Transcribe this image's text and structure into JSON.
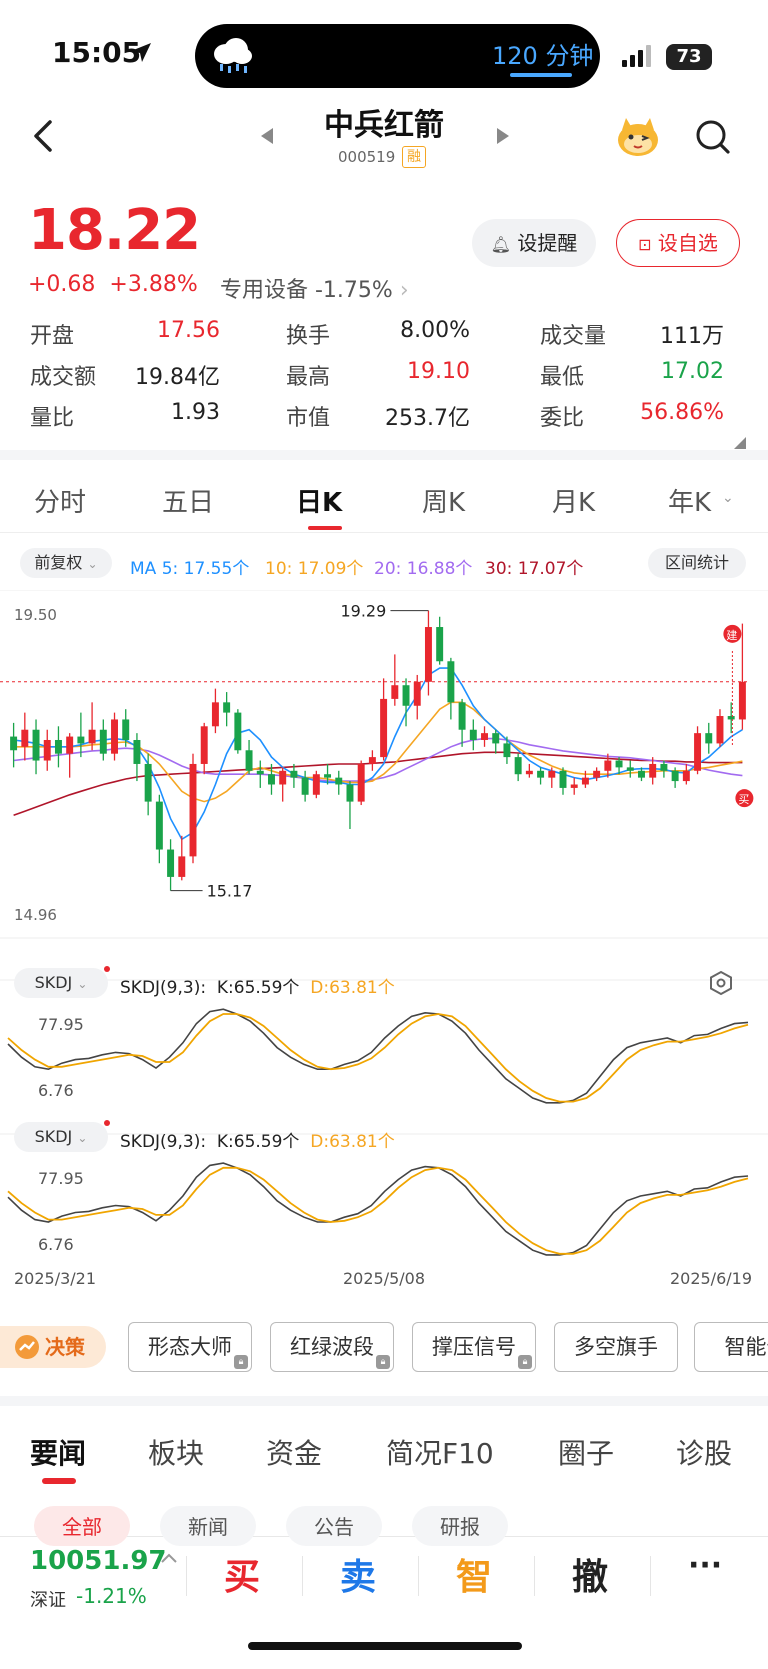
{
  "status_bar": {
    "time": "15:05",
    "timer": "120 分钟",
    "battery": "73"
  },
  "header": {
    "title": "中兵红箭",
    "code": "000519",
    "margin_badge": "融"
  },
  "quote": {
    "price": "18.22",
    "change": "+0.68",
    "change_pct": "+3.88%",
    "sector": "专用设备 -1.75%",
    "alert_label": "设提醒",
    "favorite_label": "设自选",
    "stats": [
      {
        "label": "开盘",
        "value": "17.56",
        "color": "#e8272e"
      },
      {
        "label": "换手",
        "value": "8.00%",
        "color": "#222"
      },
      {
        "label": "成交量",
        "value": "111万",
        "color": "#222"
      },
      {
        "label": "成交额",
        "value": "19.84亿",
        "color": "#222"
      },
      {
        "label": "最高",
        "value": "19.10",
        "color": "#e8272e"
      },
      {
        "label": "最低",
        "value": "17.02",
        "color": "#1aa34a"
      },
      {
        "label": "量比",
        "value": "1.93",
        "color": "#222"
      },
      {
        "label": "市值",
        "value": "253.7亿",
        "color": "#222"
      },
      {
        "label": "委比",
        "value": "56.86%",
        "color": "#e8272e"
      }
    ]
  },
  "kline_tabs": [
    "分时",
    "五日",
    "日K",
    "周K",
    "月K",
    "年K"
  ],
  "active_kline_tab": "日K",
  "chart_toolbar": {
    "adjust": "前复权",
    "ma5": "MA 5: 17.55个",
    "ma10": "10: 17.09个",
    "ma20": "20: 16.88个",
    "ma30": "30: 17.07个",
    "range_stats": "区间统计"
  },
  "indicator": {
    "name": "SKDJ",
    "params": "SKDJ(9,3):",
    "k": "K:65.59个",
    "d": "D:63.81个",
    "upper": "77.95",
    "lower": "6.76"
  },
  "chart_data": {
    "type": "candlestick",
    "y_max_label": "19.50",
    "y_min_label": "14.96",
    "high_marker": "19.29",
    "low_marker": "15.17",
    "x_labels": [
      "2025/3/21",
      "2025/5/08",
      "2025/6/19"
    ],
    "build_marker": "建",
    "buy_marker": "买",
    "candles": [
      [
        17.45,
        17.25,
        17.65,
        17.0
      ],
      [
        17.3,
        17.55,
        17.8,
        17.1
      ],
      [
        17.55,
        17.1,
        17.7,
        16.9
      ],
      [
        17.1,
        17.4,
        17.55,
        16.95
      ],
      [
        17.4,
        17.2,
        17.6,
        17.0
      ],
      [
        17.2,
        17.45,
        17.5,
        16.85
      ],
      [
        17.45,
        17.35,
        17.8,
        17.15
      ],
      [
        17.35,
        17.55,
        17.95,
        17.25
      ],
      [
        17.55,
        17.2,
        17.7,
        17.1
      ],
      [
        17.2,
        17.7,
        17.8,
        17.1
      ],
      [
        17.7,
        17.4,
        17.85,
        17.3
      ],
      [
        17.4,
        17.05,
        17.5,
        16.8
      ],
      [
        17.05,
        16.5,
        17.2,
        16.3
      ],
      [
        16.5,
        15.8,
        16.6,
        15.6
      ],
      [
        15.8,
        15.4,
        15.95,
        15.2
      ],
      [
        15.4,
        15.7,
        16.0,
        15.35
      ],
      [
        15.7,
        17.05,
        17.2,
        15.6
      ],
      [
        17.05,
        17.6,
        17.65,
        16.9
      ],
      [
        17.6,
        17.95,
        18.15,
        17.5
      ],
      [
        17.95,
        17.8,
        18.1,
        17.6
      ],
      [
        17.8,
        17.25,
        17.85,
        17.2
      ],
      [
        17.25,
        16.95,
        17.4,
        16.9
      ],
      [
        16.95,
        16.9,
        17.1,
        16.7
      ],
      [
        16.9,
        16.75,
        17.05,
        16.6
      ],
      [
        16.75,
        16.95,
        17.0,
        16.5
      ],
      [
        16.95,
        16.85,
        17.05,
        16.7
      ],
      [
        16.85,
        16.6,
        16.95,
        16.5
      ],
      [
        16.6,
        16.9,
        16.95,
        16.55
      ],
      [
        16.9,
        16.85,
        17.05,
        16.75
      ],
      [
        16.85,
        16.75,
        16.95,
        16.6
      ],
      [
        16.75,
        16.5,
        16.8,
        16.1
      ],
      [
        16.5,
        17.05,
        17.1,
        16.45
      ],
      [
        17.05,
        17.15,
        17.25,
        16.95
      ],
      [
        17.15,
        18.0,
        18.3,
        17.1
      ],
      [
        18.0,
        18.2,
        18.65,
        17.9
      ],
      [
        18.2,
        17.9,
        18.3,
        17.6
      ],
      [
        17.9,
        18.25,
        18.35,
        17.7
      ],
      [
        18.25,
        19.05,
        19.29,
        18.05
      ],
      [
        19.05,
        18.55,
        19.2,
        18.5
      ],
      [
        18.55,
        17.95,
        18.6,
        17.7
      ],
      [
        17.95,
        17.55,
        18.0,
        17.3
      ],
      [
        17.55,
        17.4,
        17.7,
        17.25
      ],
      [
        17.4,
        17.5,
        17.6,
        17.3
      ],
      [
        17.5,
        17.35,
        17.55,
        17.2
      ],
      [
        17.35,
        17.15,
        17.45,
        17.05
      ],
      [
        17.15,
        16.9,
        17.2,
        16.8
      ],
      [
        16.9,
        16.95,
        17.05,
        16.85
      ],
      [
        16.95,
        16.85,
        17.0,
        16.75
      ],
      [
        16.85,
        16.95,
        17.0,
        16.7
      ],
      [
        16.95,
        16.7,
        17.0,
        16.6
      ],
      [
        16.7,
        16.75,
        16.85,
        16.6
      ],
      [
        16.75,
        16.85,
        16.95,
        16.7
      ],
      [
        16.85,
        16.95,
        17.0,
        16.8
      ],
      [
        16.95,
        17.1,
        17.2,
        16.85
      ],
      [
        17.1,
        17.0,
        17.15,
        16.9
      ],
      [
        17.0,
        16.95,
        17.1,
        16.85
      ],
      [
        16.95,
        16.85,
        17.0,
        16.8
      ],
      [
        16.85,
        17.05,
        17.15,
        16.75
      ],
      [
        17.05,
        16.95,
        17.1,
        16.85
      ],
      [
        16.95,
        16.8,
        17.0,
        16.7
      ],
      [
        16.8,
        16.95,
        17.05,
        16.75
      ],
      [
        16.95,
        17.5,
        17.6,
        16.9
      ],
      [
        17.5,
        17.35,
        17.65,
        17.2
      ],
      [
        17.35,
        17.75,
        17.85,
        17.3
      ],
      [
        17.75,
        17.7,
        17.95,
        17.5
      ],
      [
        17.7,
        18.25,
        19.1,
        17.55
      ]
    ],
    "ma5": [
      17.4,
      17.38,
      17.35,
      17.3,
      17.3,
      17.3,
      17.33,
      17.38,
      17.4,
      17.42,
      17.4,
      17.3,
      17.05,
      16.7,
      16.25,
      15.95,
      16.05,
      16.35,
      16.75,
      17.2,
      17.5,
      17.55,
      17.4,
      17.15,
      17.0,
      16.9,
      16.85,
      16.8,
      16.78,
      16.78,
      16.75,
      16.75,
      16.85,
      17.05,
      17.45,
      17.8,
      18.05,
      18.35,
      18.45,
      18.45,
      18.2,
      17.9,
      17.7,
      17.55,
      17.4,
      17.25,
      17.1,
      17.0,
      16.95,
      16.9,
      16.85,
      16.82,
      16.85,
      16.88,
      16.92,
      16.97,
      16.98,
      16.98,
      16.97,
      16.93,
      16.92,
      17.05,
      17.15,
      17.3,
      17.45,
      17.55
    ],
    "ma10": [
      17.3,
      17.3,
      17.3,
      17.3,
      17.3,
      17.3,
      17.31,
      17.33,
      17.34,
      17.36,
      17.37,
      17.32,
      17.2,
      17.05,
      16.85,
      16.65,
      16.55,
      16.5,
      16.55,
      16.65,
      16.8,
      16.95,
      17.0,
      16.95,
      16.9,
      16.88,
      16.85,
      16.85,
      16.83,
      16.8,
      16.78,
      16.78,
      16.8,
      16.9,
      17.05,
      17.25,
      17.45,
      17.65,
      17.85,
      17.95,
      17.95,
      17.85,
      17.7,
      17.55,
      17.4,
      17.28,
      17.18,
      17.1,
      17.02,
      16.96,
      16.92,
      16.9,
      16.9,
      16.9,
      16.9,
      16.92,
      16.93,
      16.94,
      16.95,
      16.95,
      16.95,
      16.98,
      17.0,
      17.03,
      17.06,
      17.09
    ],
    "ma20": [
      17.1,
      17.12,
      17.14,
      17.16,
      17.18,
      17.2,
      17.22,
      17.24,
      17.25,
      17.27,
      17.28,
      17.27,
      17.24,
      17.18,
      17.1,
      17.02,
      16.96,
      16.92,
      16.9,
      16.9,
      16.9,
      16.9,
      16.9,
      16.89,
      16.88,
      16.86,
      16.84,
      16.82,
      16.8,
      16.8,
      16.8,
      16.8,
      16.82,
      16.85,
      16.9,
      16.98,
      17.06,
      17.14,
      17.22,
      17.3,
      17.36,
      17.4,
      17.42,
      17.42,
      17.4,
      17.37,
      17.33,
      17.3,
      17.27,
      17.24,
      17.22,
      17.2,
      17.18,
      17.16,
      17.15,
      17.14,
      17.12,
      17.1,
      17.08,
      17.06,
      17.04,
      17.0,
      16.96,
      16.93,
      16.9,
      16.88
    ],
    "ma30": [
      16.3,
      16.36,
      16.42,
      16.48,
      16.54,
      16.6,
      16.65,
      16.7,
      16.75,
      16.79,
      16.83,
      16.86,
      16.88,
      16.89,
      16.9,
      16.91,
      16.92,
      16.93,
      16.94,
      16.95,
      16.96,
      16.97,
      16.98,
      16.99,
      17.0,
      17.01,
      17.02,
      17.03,
      17.04,
      17.05,
      17.05,
      17.05,
      17.06,
      17.07,
      17.08,
      17.1,
      17.12,
      17.14,
      17.16,
      17.18,
      17.2,
      17.21,
      17.22,
      17.22,
      17.22,
      17.21,
      17.2,
      17.19,
      17.18,
      17.17,
      17.16,
      17.15,
      17.14,
      17.13,
      17.12,
      17.11,
      17.1,
      17.1,
      17.09,
      17.09,
      17.08,
      17.08,
      17.07,
      17.07,
      17.07,
      17.07
    ],
    "skdj_k": [
      55,
      44,
      36,
      34,
      39,
      42,
      43,
      46,
      48,
      47,
      42,
      35,
      44,
      56,
      72,
      82,
      84,
      80,
      74,
      64,
      52,
      44,
      38,
      34,
      34,
      38,
      41,
      48,
      60,
      70,
      78,
      81,
      80,
      74,
      64,
      50,
      38,
      26,
      18,
      10,
      6,
      6,
      8,
      14,
      28,
      42,
      52,
      56,
      58,
      60,
      56,
      62,
      63,
      68,
      72,
      73
    ],
    "skdj_d": [
      60,
      50,
      42,
      36,
      36,
      38,
      40,
      42,
      44,
      46,
      45,
      40,
      40,
      48,
      62,
      74,
      80,
      80,
      77,
      70,
      60,
      50,
      42,
      36,
      34,
      35,
      38,
      43,
      52,
      63,
      72,
      78,
      80,
      78,
      70,
      58,
      46,
      34,
      24,
      16,
      10,
      7,
      7,
      10,
      18,
      30,
      42,
      50,
      54,
      57,
      57,
      59,
      61,
      64,
      68,
      71
    ]
  },
  "decision": {
    "badge": "决策",
    "chips": [
      "形态大师",
      "红绿波段",
      "撑压信号",
      "多空旗手",
      "智能优"
    ]
  },
  "news_tabs": [
    "要闻",
    "板块",
    "资金",
    "简况F10",
    "圈子",
    "诊股"
  ],
  "news_subtabs": [
    "全部",
    "新闻",
    "公告",
    "研报"
  ],
  "bottom_bar": {
    "index_value": "10051.97",
    "index_name": "深证",
    "index_change": "-1.21%",
    "buy": "买",
    "sell": "卖",
    "smart": "智",
    "cancel": "撤",
    "more": "···"
  }
}
